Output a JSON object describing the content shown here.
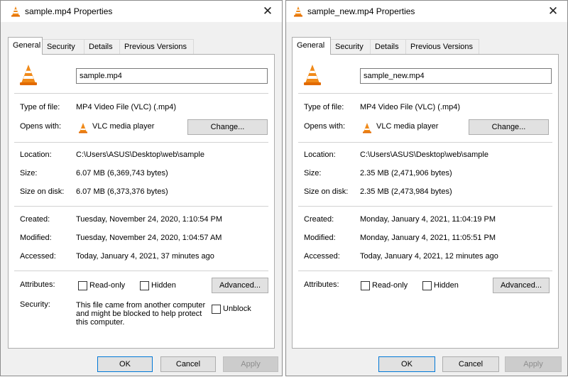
{
  "dialogs": [
    {
      "title": "sample.mp4 Properties",
      "tabs": [
        "General",
        "Security",
        "Details",
        "Previous Versions"
      ],
      "filename": "sample.mp4",
      "type_label": "Type of file:",
      "type_value": "MP4 Video File (VLC) (.mp4)",
      "opens_label": "Opens with:",
      "opens_app": "VLC media player",
      "change_label": "Change...",
      "location_label": "Location:",
      "location_value": "C:\\Users\\ASUS\\Desktop\\web\\sample",
      "size_label": "Size:",
      "size_value": "6.07 MB (6,369,743 bytes)",
      "disk_label": "Size on disk:",
      "disk_value": "6.07 MB (6,373,376 bytes)",
      "created_label": "Created:",
      "created_value": "Tuesday, November 24, 2020, 1:10:54 PM",
      "modified_label": "Modified:",
      "modified_value": "Tuesday, November 24, 2020, 1:04:57 AM",
      "accessed_label": "Accessed:",
      "accessed_value": "Today, January 4, 2021, 37 minutes ago",
      "attributes_label": "Attributes:",
      "readonly_label": "Read-only",
      "hidden_label": "Hidden",
      "advanced_label": "Advanced...",
      "security_label": "Security:",
      "security_text": "This file came from another computer and might be blocked to help protect this computer.",
      "unblock_label": "Unblock",
      "ok_label": "OK",
      "cancel_label": "Cancel",
      "apply_label": "Apply"
    },
    {
      "title": "sample_new.mp4 Properties",
      "tabs": [
        "General",
        "Security",
        "Details",
        "Previous Versions"
      ],
      "filename": "sample_new.mp4",
      "type_label": "Type of file:",
      "type_value": "MP4 Video File (VLC) (.mp4)",
      "opens_label": "Opens with:",
      "opens_app": "VLC media player",
      "change_label": "Change...",
      "location_label": "Location:",
      "location_value": "C:\\Users\\ASUS\\Desktop\\web\\sample",
      "size_label": "Size:",
      "size_value": "2.35 MB (2,471,906 bytes)",
      "disk_label": "Size on disk:",
      "disk_value": "2.35 MB (2,473,984 bytes)",
      "created_label": "Created:",
      "created_value": "Monday, January 4, 2021, 11:04:19 PM",
      "modified_label": "Modified:",
      "modified_value": "Monday, January 4, 2021, 11:05:51 PM",
      "accessed_label": "Accessed:",
      "accessed_value": "Today, January 4, 2021, 12 minutes ago",
      "attributes_label": "Attributes:",
      "readonly_label": "Read-only",
      "hidden_label": "Hidden",
      "advanced_label": "Advanced...",
      "ok_label": "OK",
      "cancel_label": "Cancel",
      "apply_label": "Apply"
    }
  ],
  "icons": {
    "app": "vlc-cone-icon",
    "close": "close-icon"
  },
  "colors": {
    "accent": "#0078d7",
    "vlc_orange": "#f08a1a"
  }
}
